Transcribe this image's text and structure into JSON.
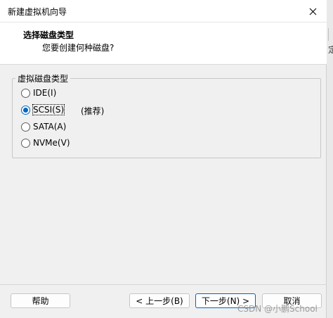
{
  "window": {
    "title": "新建虚拟机向导"
  },
  "header": {
    "title": "选择磁盘类型",
    "subtitle": "您要创建何种磁盘?"
  },
  "disk_type_group": {
    "legend": "虚拟磁盘类型",
    "options": [
      {
        "label": "IDE(I)",
        "checked": false
      },
      {
        "label": "SCSI(S)",
        "checked": true
      },
      {
        "label": "SATA(A)",
        "checked": false
      },
      {
        "label": "NVMe(V)",
        "checked": false
      }
    ],
    "recommend_note": "(推荐)"
  },
  "buttons": {
    "help": "帮助",
    "back": "< 上一步(B)",
    "next": "下一步(N) >",
    "cancel": "取消"
  },
  "watermark": "CSDN @小鹏School",
  "background_app": {
    "edge_glyph": "定"
  },
  "colors": {
    "accent": "#0067c0",
    "dialog_bg": "#f0f0f0",
    "header_bg": "#ffffff"
  }
}
